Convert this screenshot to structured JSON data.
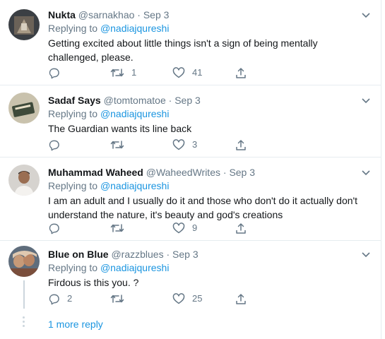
{
  "colors": {
    "text": "#14171a",
    "secondary": "#657786",
    "link": "#1b95e0",
    "divider": "#e6ecf0",
    "thread": "#ccd6dd"
  },
  "tweets": [
    {
      "name": "Nukta",
      "handle": "@sarnakhao",
      "dot": "·",
      "date": "Sep 3",
      "replying_prefix": "Replying to ",
      "replying_to": "@nadiajqureshi",
      "text": "Getting excited about little things isn't a sign of being mentally challenged, please.",
      "replies": "",
      "retweets": "1",
      "likes": "41"
    },
    {
      "name": "Sadaf Says",
      "handle": "@tomtomatoe",
      "dot": "·",
      "date": "Sep 3",
      "replying_prefix": "Replying to ",
      "replying_to": "@nadiajqureshi",
      "text": "The Guardian wants its line back",
      "replies": "",
      "retweets": "",
      "likes": "3"
    },
    {
      "name": "Muhammad Waheed",
      "handle": "@WaheedWrites",
      "dot": "·",
      "date": "Sep 3",
      "replying_prefix": "Replying to ",
      "replying_to": "@nadiajqureshi",
      "text": "I am an adult and I usually do it and those who don't do it actually don't understand the nature, it's beauty and god's creations",
      "replies": "",
      "retweets": "",
      "likes": "9"
    },
    {
      "name": "Blue on Blue",
      "handle": "@razzblues",
      "dot": "·",
      "date": "Sep 3",
      "replying_prefix": "Replying to ",
      "replying_to": "@nadiajqureshi",
      "text": "Firdous is this you. ?",
      "replies": "2",
      "retweets": "",
      "likes": "25"
    }
  ],
  "more_reply_label": "1 more reply"
}
